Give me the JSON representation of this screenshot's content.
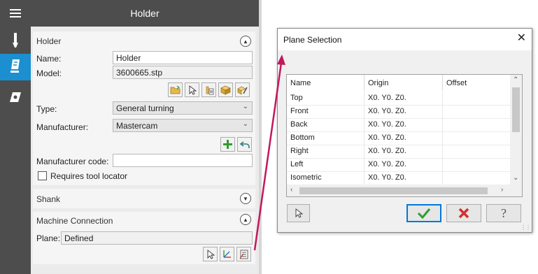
{
  "colors": {
    "toolbar_bg": "#4d4d4d",
    "active_tab": "#1b8fd0",
    "arrow": "#c2185b",
    "ok_green": "#2e9e2e",
    "cancel_red": "#d32f2f"
  },
  "toolbar": {
    "icons": [
      "hamburger-menu-icon",
      "tool-tab-icon",
      "holder-tab-icon",
      "insert-tab-icon"
    ]
  },
  "panel": {
    "title": "Holder"
  },
  "holder": {
    "section_title": "Holder",
    "name_label": "Name:",
    "name_value": "Holder",
    "model_label": "Model:",
    "model_value": "3600665.stp",
    "type_label": "Type:",
    "type_value": "General turning",
    "manufacturer_label": "Manufacturer:",
    "manufacturer_value": "Mastercam",
    "manufacturer_code_label": "Manufacturer code:",
    "manufacturer_code_value": "",
    "requires_locator_label": "Requires tool locator",
    "requires_locator_checked": false
  },
  "shank": {
    "section_title": "Shank"
  },
  "machine_connection": {
    "section_title": "Machine Connection",
    "plane_label": "Plane:",
    "plane_value": "Defined"
  },
  "dialog": {
    "title": "Plane Selection",
    "columns": [
      "Name",
      "Origin",
      "Offset"
    ],
    "rows": [
      {
        "name": "Top",
        "origin": "X0. Y0. Z0.",
        "offset": ""
      },
      {
        "name": "Front",
        "origin": "X0. Y0. Z0.",
        "offset": ""
      },
      {
        "name": "Back",
        "origin": "X0. Y0. Z0.",
        "offset": ""
      },
      {
        "name": "Bottom",
        "origin": "X0. Y0. Z0.",
        "offset": ""
      },
      {
        "name": "Right",
        "origin": "X0. Y0. Z0.",
        "offset": ""
      },
      {
        "name": "Left",
        "origin": "X0. Y0. Z0.",
        "offset": ""
      },
      {
        "name": "Isometric",
        "origin": "X0. Y0. Z0.",
        "offset": ""
      }
    ]
  }
}
